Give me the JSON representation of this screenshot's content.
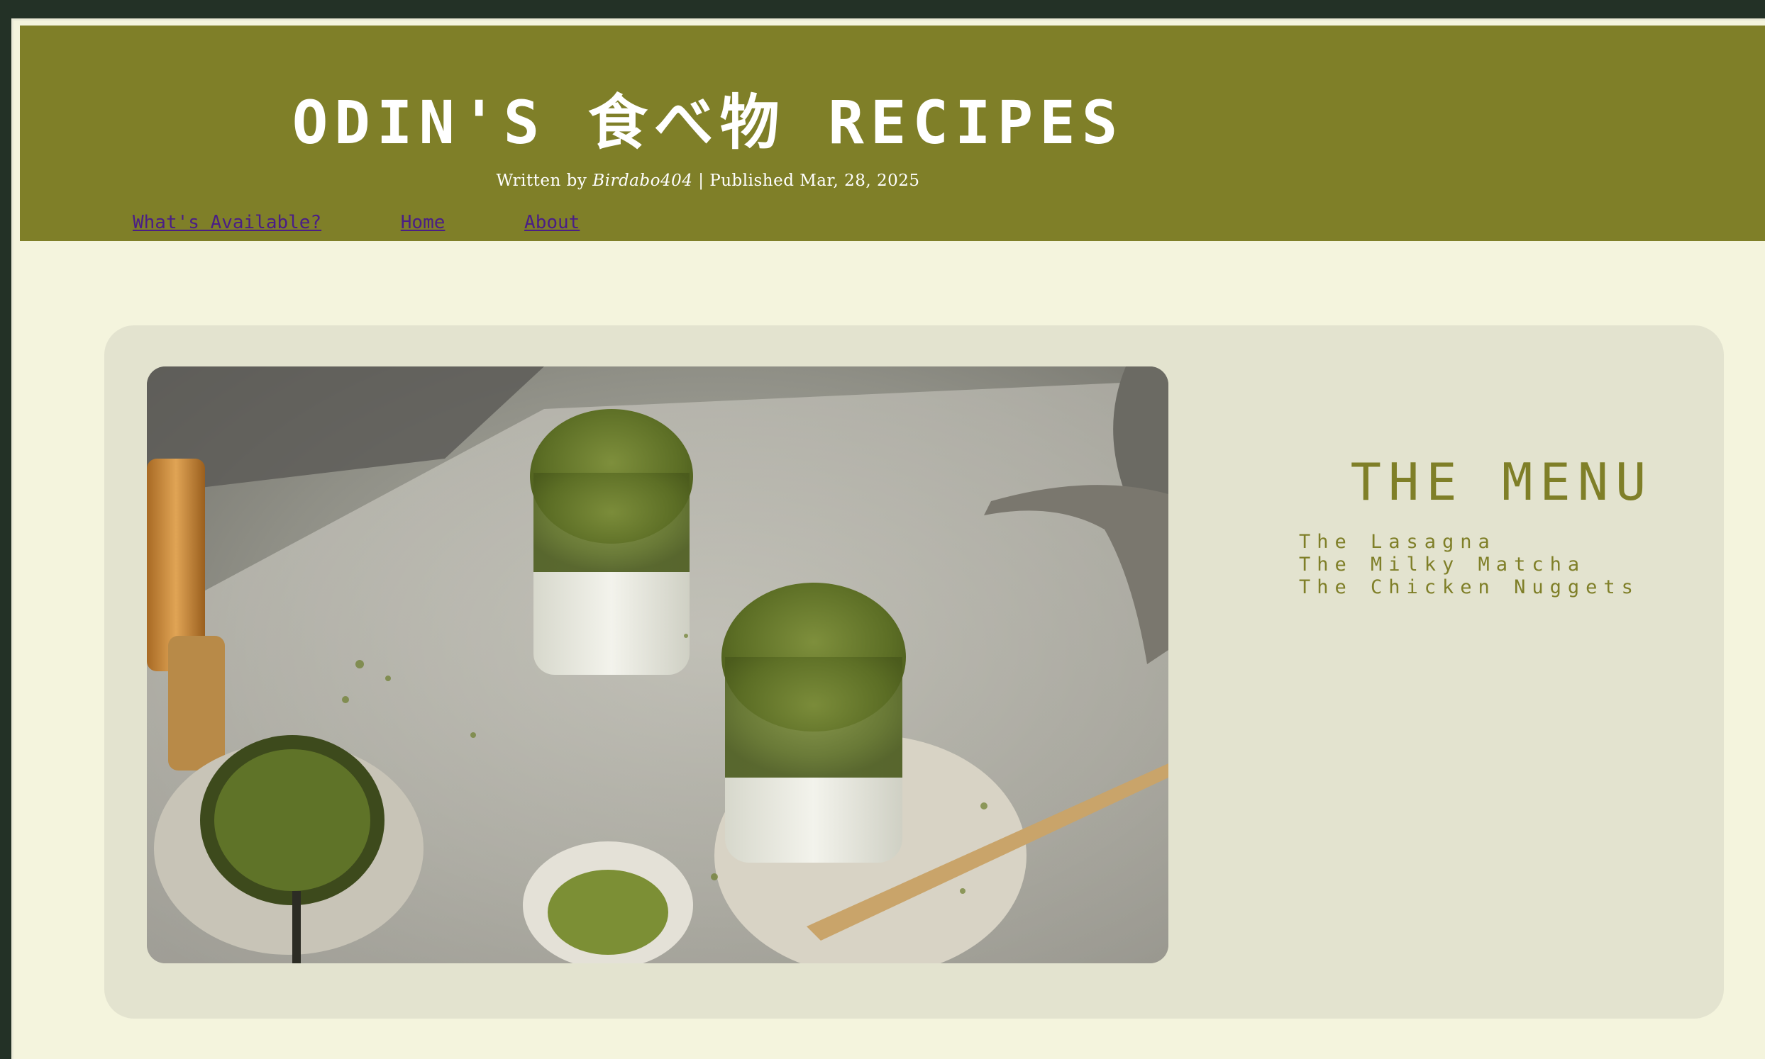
{
  "header": {
    "title": "ODIN'S 食べ物 RECIPES",
    "byline_prefix": "Written by",
    "author": "Birdabo404",
    "byline_suffix": "| Published Mar, 28, 2025"
  },
  "nav": {
    "items": [
      {
        "label": "What's Available?"
      },
      {
        "label": "Home"
      },
      {
        "label": "About"
      }
    ]
  },
  "menu": {
    "title": "THE MENU",
    "items": [
      {
        "label": "The Lasagna"
      },
      {
        "label": "The Milky Matcha"
      },
      {
        "label": "The Chicken Nuggets"
      }
    ]
  },
  "colors": {
    "header_bg": "#7f7f28",
    "page_bg": "#f4f4dd",
    "card_bg": "#e3e3cf",
    "accent": "#7f7f28",
    "link": "#4a1e86"
  }
}
